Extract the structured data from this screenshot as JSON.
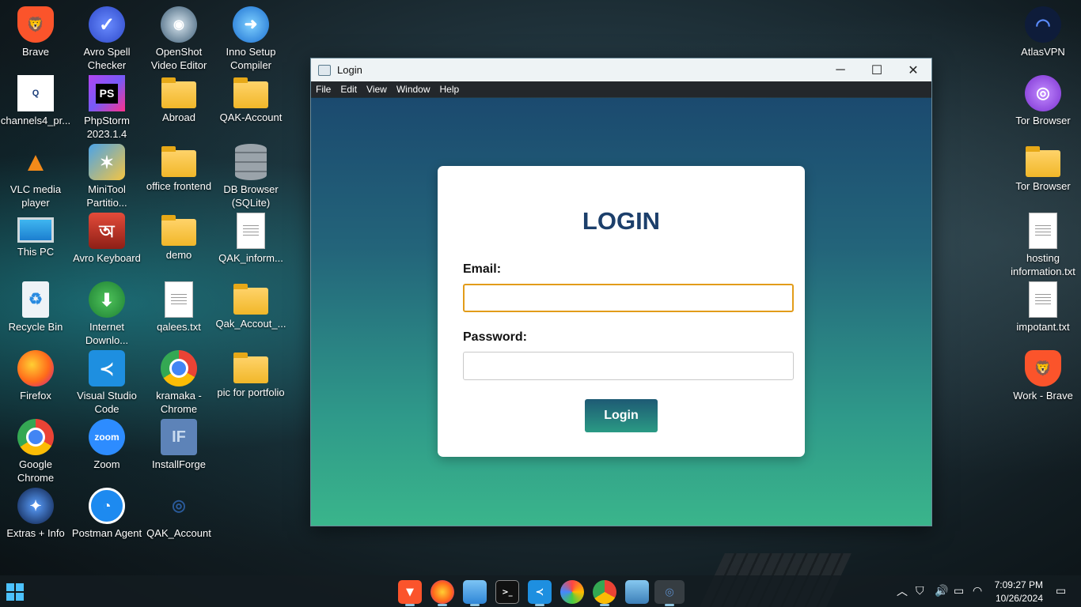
{
  "desktop": {
    "icons": {
      "brave": "Brave",
      "avro_spell": "Avro Spell Checker",
      "openshot": "OpenShot Video Editor",
      "inno": "Inno Setup Compiler",
      "atlasvpn": "AtlasVPN",
      "channels4": "channels4_pr...",
      "phpstorm": "PhpStorm 2023.1.4",
      "abroad": "Abroad",
      "qak_account_folder": "QAK-Account",
      "tor_browser_app": "Tor Browser",
      "vlc": "VLC media player",
      "minitool": "MiniTool Partitio...",
      "office_frontend": "office frontend",
      "db_browser": "DB Browser (SQLite)",
      "tor_browser_folder": "Tor Browser",
      "this_pc": "This PC",
      "avro_keyboard": "Avro Keyboard",
      "demo": "demo",
      "qak_inform": "QAK_inform...",
      "hosting_info": "hosting information.txt",
      "recycle_bin": "Recycle Bin",
      "internet_download": "Internet Downlo...",
      "qalees": "qalees.txt",
      "qak_accout": "Qak_Accout_...",
      "impotant": "impotant.txt",
      "firefox": "Firefox",
      "vscode": "Visual Studio Code",
      "kramaka": "kramaka - Chrome",
      "pic_portfolio": "pic for portfolio",
      "work_brave": "Work - Brave",
      "google_chrome": "Google Chrome",
      "zoom": "Zoom",
      "installforge": "InstallForge",
      "extras": "Extras + Info",
      "postman": "Postman Agent",
      "qak_account_app": "QAK_Account"
    },
    "glyphs": {
      "phpstorm": "PS",
      "zoom": "zoom",
      "installforge": "IF"
    }
  },
  "window": {
    "title": "Login",
    "minimize": "─",
    "maximize": "☐",
    "close": "✕",
    "menu": [
      "File",
      "Edit",
      "View",
      "Window",
      "Help"
    ]
  },
  "login": {
    "heading": "LOGIN",
    "email_label": "Email:",
    "email_value": "",
    "password_label": "Password:",
    "password_value": "",
    "button_label": "Login"
  },
  "taskbar": {
    "time": "7:09:27 PM",
    "date": "10/26/2024"
  },
  "colors": {
    "heading": "#1c3f6b",
    "focus_border": "#e29c1a",
    "gradient_top": "#1b4a6f",
    "gradient_bottom": "#3ab58b"
  }
}
